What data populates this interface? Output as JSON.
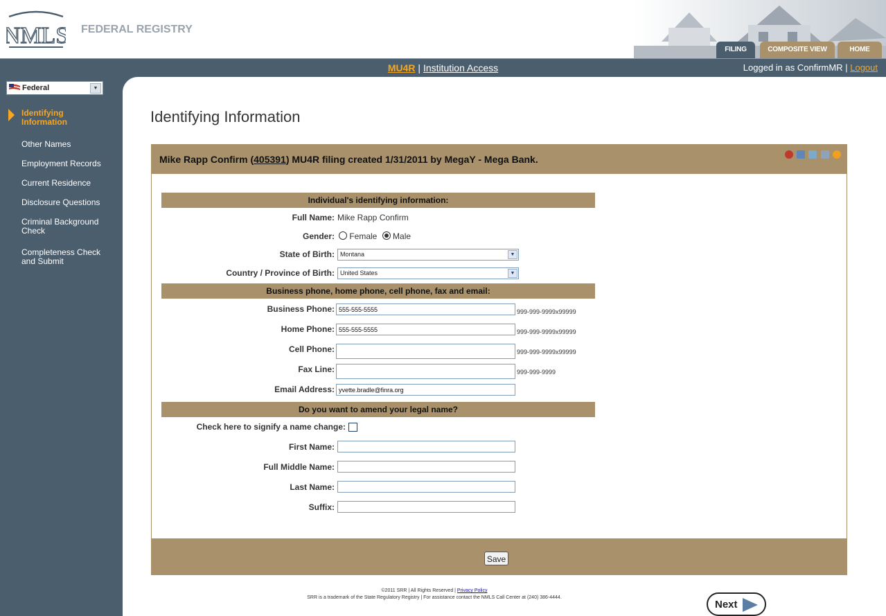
{
  "header": {
    "logo_text": "NMLS",
    "registry_title": "FEDERAL REGISTRY",
    "tabs": [
      {
        "label": "FILING"
      },
      {
        "label": "COMPOSITE VIEW"
      },
      {
        "label": "HOME"
      }
    ]
  },
  "navbar": {
    "filing_code": "MU4R",
    "separator": "|",
    "access_label": "Institution Access",
    "logged_in": "Logged in as ConfirmMR",
    "logout_label": "Logout"
  },
  "sidebar": {
    "registry_select": "Federal",
    "items": [
      {
        "label": "Identifying\nInformation"
      },
      {
        "label": "Other Names"
      },
      {
        "label": "Employment Records"
      },
      {
        "label": "Current Residence"
      },
      {
        "label": "Disclosure Questions"
      },
      {
        "label": "Criminal Background\nCheck"
      },
      {
        "label": "Completeness Check\nand Submit"
      }
    ]
  },
  "main": {
    "page_title": "Identifying Information",
    "panel": {
      "title_prefix": "Mike Rapp Confirm (",
      "title_id": "405391",
      "title_suffix": ") MU4R filing created 1/31/2011 by MegaY - Mega Bank.",
      "icons": [
        "globe-icon",
        "grid-icon",
        "people-icon",
        "print-icon",
        "help-icon"
      ]
    },
    "section1": {
      "title": "Individual's identifying information:",
      "full_name_label": "Full Name:",
      "full_name_value": "Mike Rapp Confirm",
      "gender_label": "Gender:",
      "gender_female": "Female",
      "gender_male": "Male",
      "gender_selected": "Male",
      "state_label": "State of Birth:",
      "state_value": "Montana",
      "country_label": "Country / Province of Birth:",
      "country_value": "United States"
    },
    "section2": {
      "title": "Business phone, home phone, cell phone, fax and email:",
      "business_label": "Business Phone:",
      "business_value": "555-555-5555",
      "business_format": "999-999-9999x99999",
      "home_label": "Home Phone:",
      "home_value": "555-555-5555",
      "home_format": "999-999-9999x99999",
      "cell_label": "Cell Phone:",
      "cell_value": "",
      "cell_format": "999-999-9999x99999",
      "fax_label": "Fax Line:",
      "fax_value": "",
      "fax_format": "999-999-9999",
      "email_label": "Email Address:",
      "email_value": "yvette.bradle@finra.org"
    },
    "section3": {
      "title": "Do you want to amend your legal name?",
      "checkbox_label": "Check here to signify a name change:",
      "first_label": "First Name:",
      "middle_label": "Full Middle Name:",
      "last_label": "Last Name:",
      "suffix_label": "Suffix:"
    },
    "save_label": "Save",
    "next_label": "Next"
  },
  "footer": {
    "line1_prefix": "©2011 SRR | All Rights Reserved | ",
    "privacy_label": "Privacy Policy",
    "line2": "SRR is a trademark of the State Regulatory Registry | For assistance contact the NMLS Call Center at (240) 386-4444."
  },
  "colors": {
    "accent": "#f5a623",
    "tan": "#a8916b",
    "slate": "#4b5e6e"
  }
}
